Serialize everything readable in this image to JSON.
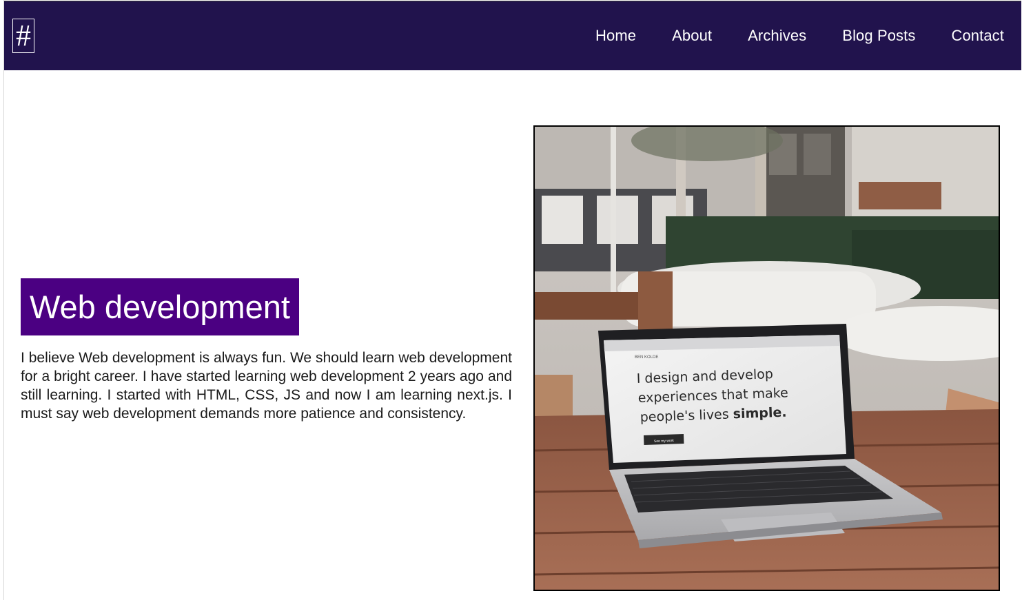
{
  "header": {
    "logo_text": "#",
    "nav": [
      "Home",
      "About",
      "Archives",
      "Blog Posts",
      "Contact"
    ],
    "background_color": "#21134d"
  },
  "main": {
    "heading": "Web development",
    "heading_bg": "#4b0082",
    "paragraph": "I believe Web development is always fun. We should learn web development for a bright career. I have started learning web development 2 years ago and still learning. I started with HTML, CSS, JS and now I am learning next.js. I must say web development demands more patience and consistency."
  },
  "photo": {
    "brand": "BEN KOLDE",
    "screen_line1": "I design and develop",
    "screen_line2": "experiences that make",
    "screen_line3_a": "people's lives ",
    "screen_line3_b": "simple.",
    "screen_button": "See my work"
  }
}
